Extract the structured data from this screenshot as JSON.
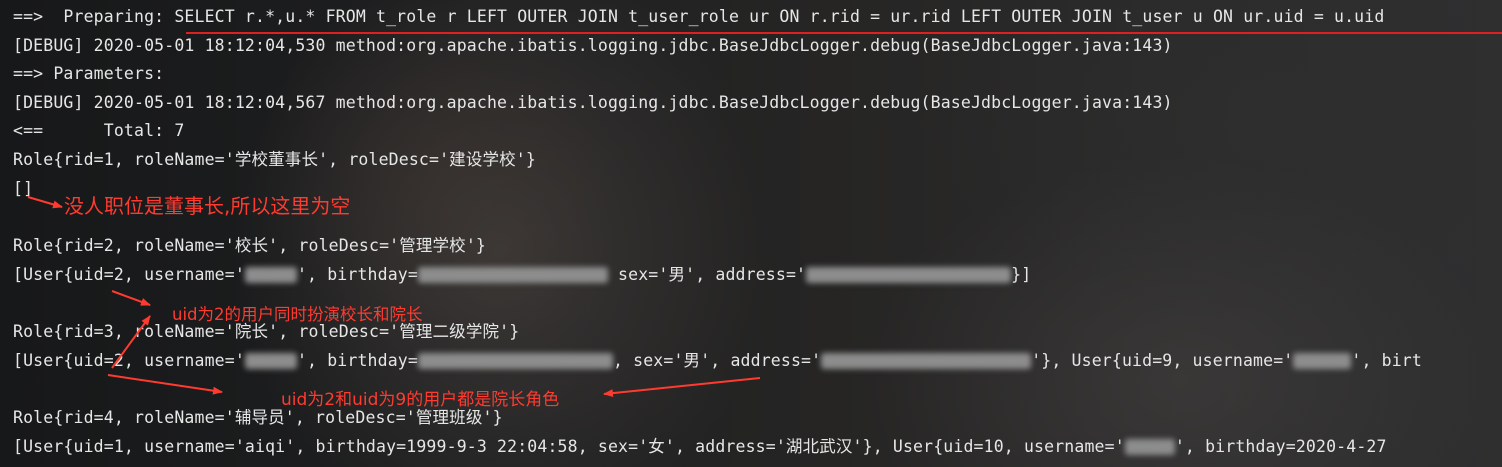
{
  "terminal": {
    "lines": {
      "l1": "==>  Preparing: SELECT r.*,u.* FROM t_role r LEFT OUTER JOIN t_user_role ur ON r.rid = ur.rid LEFT OUTER JOIN t_user u ON ur.uid = u.uid",
      "l2": "[DEBUG] 2020-05-01 18:12:04,530 method:org.apache.ibatis.logging.jdbc.BaseJdbcLogger.debug(BaseJdbcLogger.java:143)",
      "l3": "==> Parameters: ",
      "l4": "[DEBUG] 2020-05-01 18:12:04,567 method:org.apache.ibatis.logging.jdbc.BaseJdbcLogger.debug(BaseJdbcLogger.java:143)",
      "l5": "<==      Total: 7",
      "l6": "Role{rid=1, roleName='学校董事长', roleDesc='建设学校'}",
      "l7": "[]",
      "l8": "Role{rid=2, roleName='校长', roleDesc='管理学校'}",
      "l9": {
        "a": "[User{uid=2, username='",
        "b": "', birthday=",
        "c": " sex='男', address='",
        "d": "}]"
      },
      "l10": "Role{rid=3, roleName='院长', roleDesc='管理二级学院'}",
      "l11": {
        "a": "[User{uid=2, username='",
        "b": "', birthday=",
        "c": ", sex='男', address='",
        "d": "'}, User{uid=9, username='",
        "e": "', birt"
      },
      "l12": "Role{rid=4, roleName='辅导员', roleDesc='管理班级'}",
      "l13": {
        "a": "[User{uid=1, username='aiqi', birthday=1999-9-3 22:04:58, sex='女', address='湖北武汉'}, User{uid=10, username='",
        "b": "', birthday=2020-4-27"
      }
    }
  },
  "annotations": {
    "empty_note": "没人职位是董事长,所以这里为空",
    "uid2_note": "uid为2的用户同时扮演校长和院长",
    "uid2_uid9_note": "uid为2和uid为9的用户都是院长角色"
  },
  "colors": {
    "annotation": "#ff3b30",
    "underline": "#e02020",
    "terminal_text": "#e6e6e6"
  }
}
